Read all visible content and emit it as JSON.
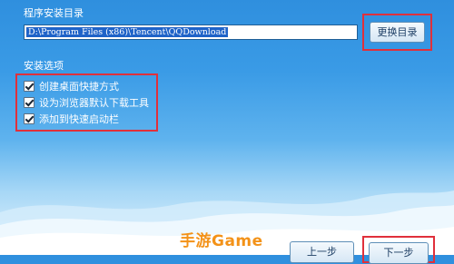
{
  "install_dir": {
    "section_label": "程序安装目录",
    "path_value": "D:\\Program Files (x86)\\Tencent\\QQDownload",
    "change_button_label": "更换目录"
  },
  "options": {
    "section_label": "安装选项",
    "items": [
      {
        "label": "创建桌面快捷方式",
        "checked": true
      },
      {
        "label": "设为浏览器默认下载工具",
        "checked": true
      },
      {
        "label": "添加到快速启动栏",
        "checked": true
      }
    ]
  },
  "footer": {
    "back_button_label": "上一步",
    "next_button_label": "下一步"
  },
  "watermark": "手游Game",
  "colors": {
    "highlight_box": "#e0303b",
    "sky_top": "#2f8fde",
    "watermark": "#f39218"
  }
}
